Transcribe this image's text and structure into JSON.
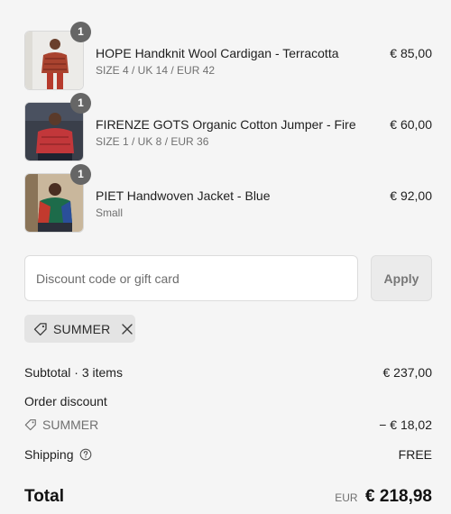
{
  "line_items": [
    {
      "title": "HOPE Handknit Wool Cardigan - Terracotta",
      "variant": "SIZE 4 / UK 14 / EUR 42",
      "price": "€ 85,00",
      "quantity": "1",
      "image": "product-photo-cardigan"
    },
    {
      "title": "FIRENZE GOTS Organic Cotton Jumper - Fire",
      "variant": "SIZE 1 / UK 8 / EUR 36",
      "price": "€ 60,00",
      "quantity": "1",
      "image": "product-photo-jumper"
    },
    {
      "title": "PIET Handwoven Jacket - Blue",
      "variant": "Small",
      "price": "€ 92,00",
      "quantity": "1",
      "image": "product-photo-jacket"
    }
  ],
  "discount": {
    "placeholder": "Discount code or gift card",
    "value": "",
    "apply_label": "Apply",
    "applied_code": "SUMMER"
  },
  "summary": {
    "subtotal_label": "Subtotal · 3 items",
    "subtotal_value": "€ 237,00",
    "order_discount_label": "Order discount",
    "discount_code": "SUMMER",
    "discount_value": "− € 18,02",
    "shipping_label": "Shipping",
    "shipping_value": "FREE",
    "total_label": "Total",
    "currency": "EUR",
    "total_value": "€ 218,98"
  },
  "colors": {
    "background": "#f5f5f5",
    "badge": "#666666",
    "chip": "#e4e4e4"
  }
}
